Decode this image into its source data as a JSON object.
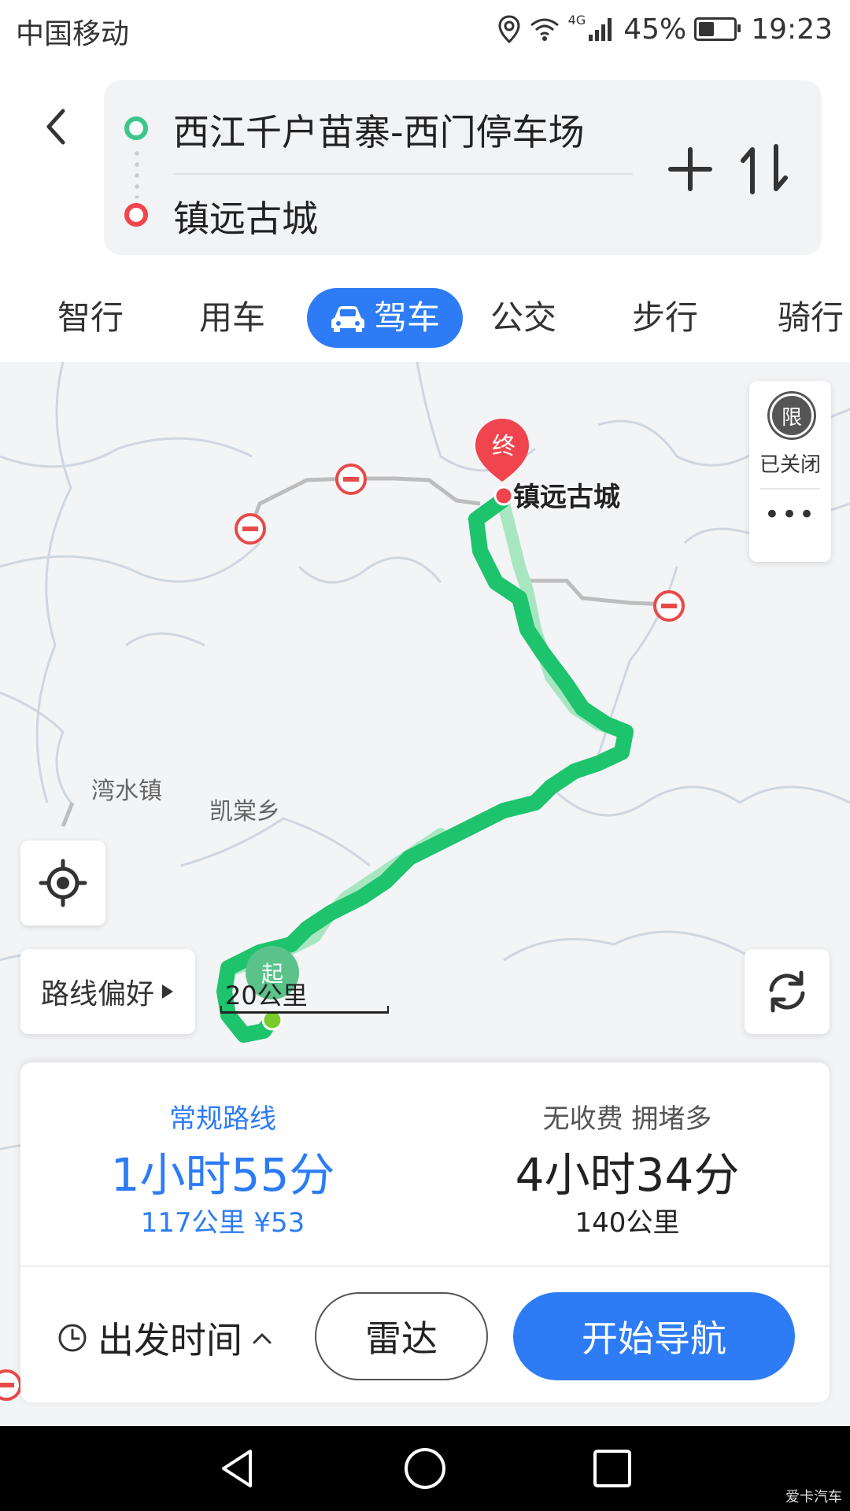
{
  "status_bar": {
    "carrier": "中国移动",
    "network": "4G",
    "battery": "45%",
    "battery_level": 0.45,
    "time": "19:23"
  },
  "route": {
    "start": "西江千户苗寨-西门停车场",
    "end": "镇远古城"
  },
  "tabs": [
    {
      "label": "智行"
    },
    {
      "label": "用车"
    },
    {
      "label": "驾车",
      "active": true
    },
    {
      "label": "公交"
    },
    {
      "label": "步行"
    },
    {
      "label": "骑行"
    }
  ],
  "map": {
    "destination_marker": "终",
    "destination_label": "镇远古城",
    "start_marker": "起",
    "place_labels": [
      "湾水镇",
      "凯棠乡"
    ],
    "scale_label": "20公里",
    "traffic_limit_icon": "限",
    "traffic_limit_status": "已关闭",
    "more_label": "•••",
    "route_preference_label": "路线偏好",
    "colors": {
      "route": "#1ec36d",
      "alt_route": "#a8e6c2",
      "blocked": "#e84a4a"
    }
  },
  "route_options": [
    {
      "label": "常规路线",
      "duration": "1小时55分",
      "info": "117公里  ¥53",
      "selected": true
    },
    {
      "label": "无收费  拥堵多",
      "duration": "4小时34分",
      "info": "140公里",
      "selected": false
    }
  ],
  "actions": {
    "depart_time": "出发时间",
    "radar": "雷达",
    "start_navigation": "开始导航"
  },
  "watermark": "爱卡汽车",
  "colors": {
    "accent": "#2d7cf6"
  }
}
